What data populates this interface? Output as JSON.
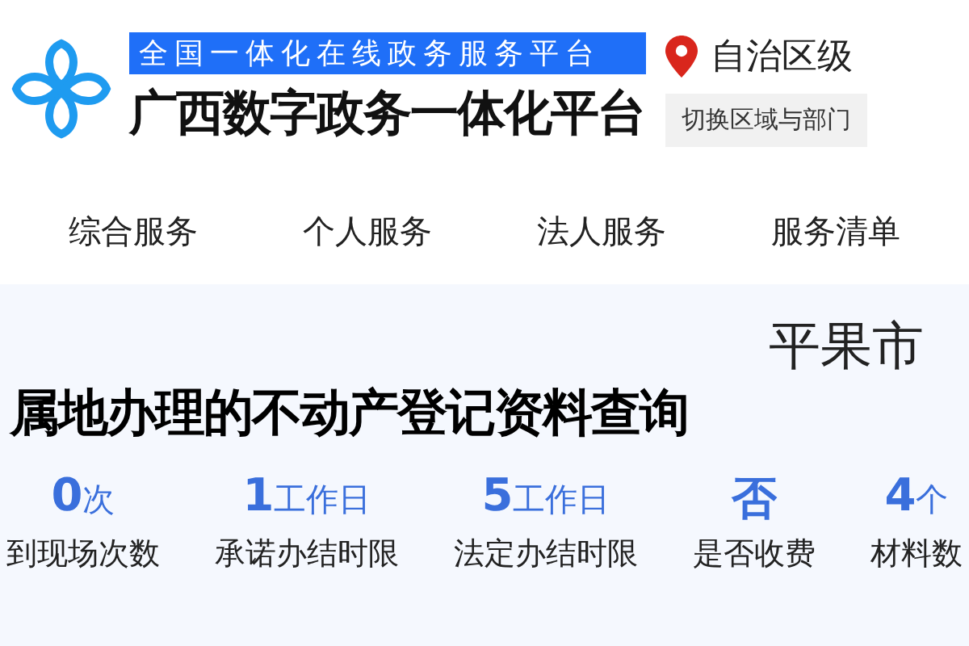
{
  "header": {
    "banner": "全国一体化在线政务服务平台",
    "title": "广西数字政务一体化平台",
    "region": "自治区级",
    "switch_button": "切换区域与部门"
  },
  "nav": [
    {
      "label": "综合服务"
    },
    {
      "label": "个人服务"
    },
    {
      "label": "法人服务"
    },
    {
      "label": "服务清单"
    }
  ],
  "city": "平果市",
  "page_title": "属地办理的不动产登记资料查询",
  "stats": [
    {
      "number": "0",
      "unit": "次",
      "label": "到现场次数"
    },
    {
      "number": "1",
      "unit": "工作日",
      "label": "承诺办结时限"
    },
    {
      "number": "5",
      "unit": "工作日",
      "label": "法定办结时限"
    },
    {
      "unit": "否",
      "label": "是否收费"
    },
    {
      "number": "4",
      "unit": "个",
      "label": "材料数"
    }
  ]
}
